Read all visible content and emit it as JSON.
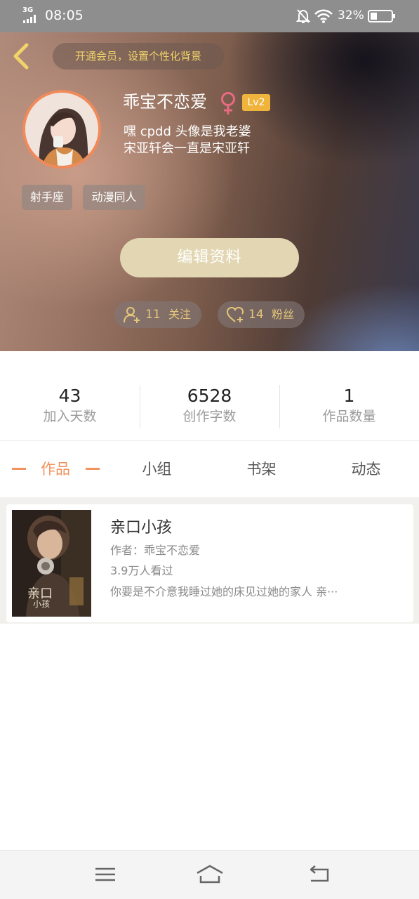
{
  "status_bar": {
    "network": "3G",
    "time": "08:05",
    "battery_percent": "32%",
    "battery_level": 0.32,
    "icons": [
      "signal-icon",
      "bell-muted-icon",
      "wifi-icon",
      "battery-icon"
    ]
  },
  "header": {
    "back_icon": "chevron-left-icon",
    "vip_banner": "开通会员，设置个性化背景",
    "username": "乖宝不恋爱",
    "gender_icon": "female-icon",
    "level": "Lv2",
    "bio_line1": "嘿  cpdd  头像是我老婆",
    "bio_line2": "宋亚轩会一直是宋亚轩",
    "tags": [
      "射手座",
      "动漫同人"
    ],
    "edit_button": "编辑资料",
    "following": {
      "count": "11",
      "label": "关注",
      "icon": "add-user-icon"
    },
    "followers": {
      "count": "14",
      "label": "粉丝",
      "icon": "heart-plus-icon"
    }
  },
  "stats": [
    {
      "value": "43",
      "label": "加入天数"
    },
    {
      "value": "6528",
      "label": "创作字数"
    },
    {
      "value": "1",
      "label": "作品数量"
    }
  ],
  "tabs": [
    {
      "label": "作品",
      "active": true
    },
    {
      "label": "小组",
      "active": false
    },
    {
      "label": "书架",
      "active": false
    },
    {
      "label": "动态",
      "active": false
    }
  ],
  "works": [
    {
      "title": "亲口小孩",
      "author": "作者：乖宝不恋爱",
      "views": "3.9万人看过",
      "description": "你要是不介意我睡过她的床见过她的家人  亲···",
      "cover_text": "亲口小孩"
    }
  ],
  "nav_bar": {
    "icons": [
      "menu-icon",
      "home-icon",
      "back-nav-icon"
    ]
  },
  "colors": {
    "accent": "#f0935e",
    "vip_text": "#f1d36a",
    "level_badge": "#f0b33b",
    "edit_button": "#e3d7b3",
    "female": "#e86a82"
  }
}
